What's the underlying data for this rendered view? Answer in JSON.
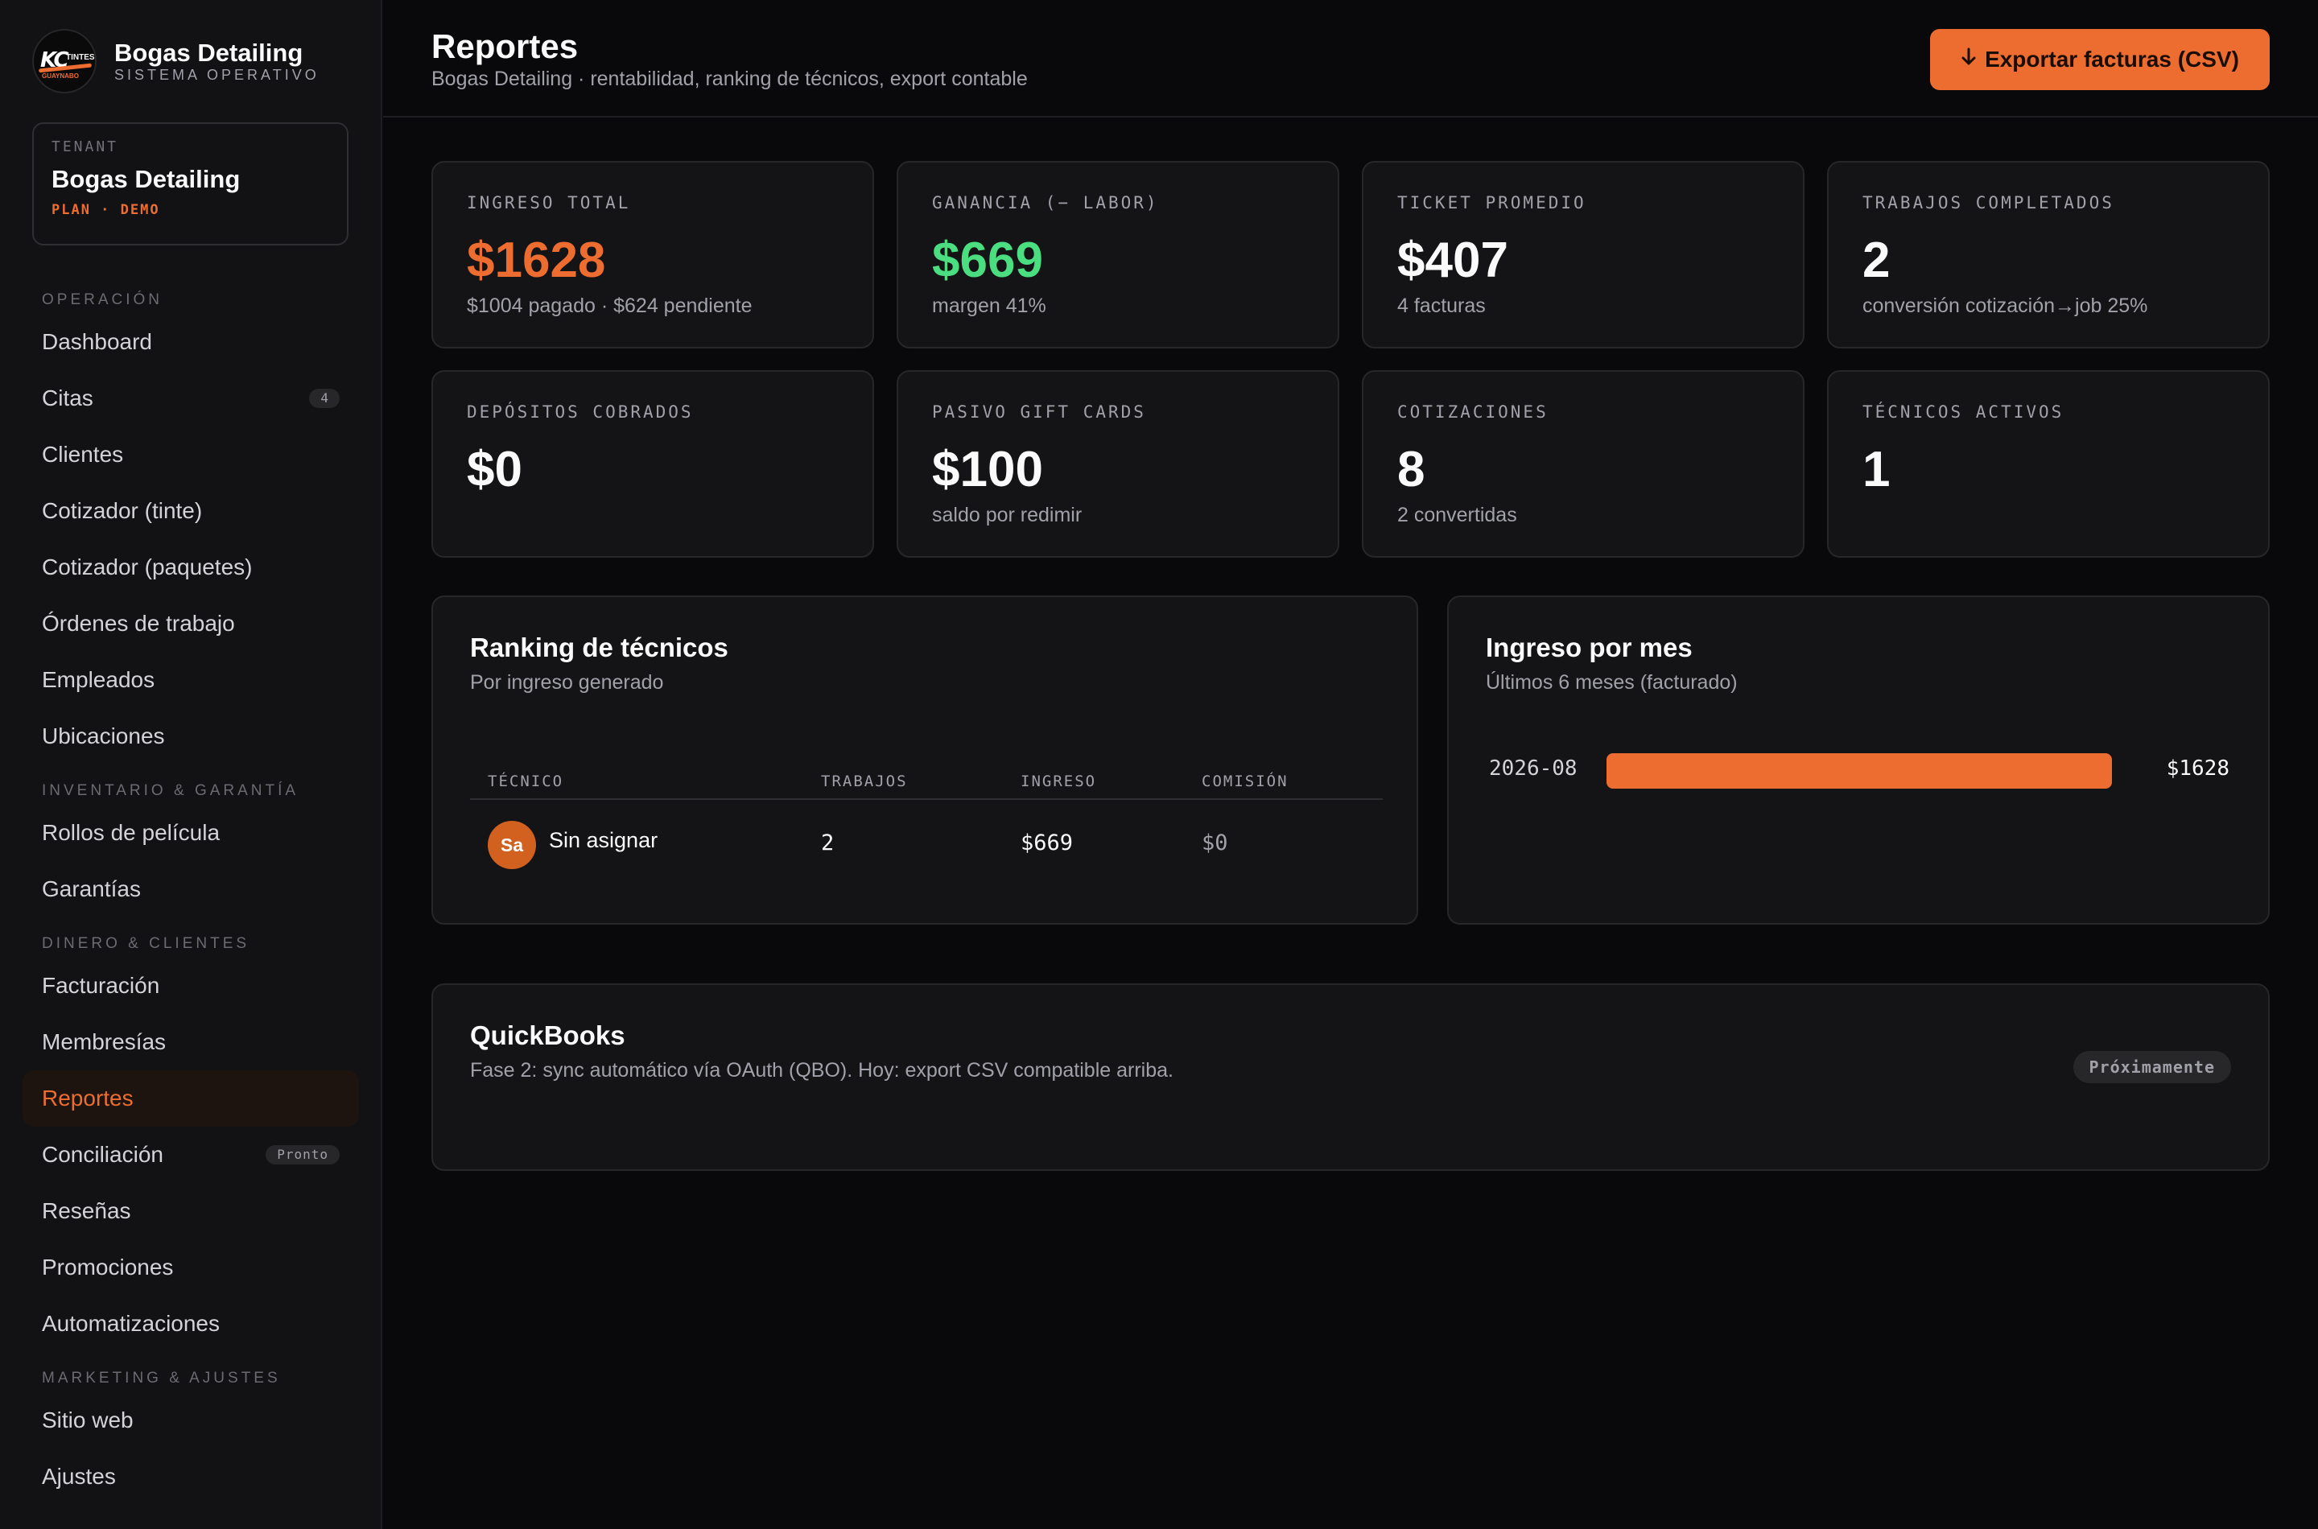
{
  "brand": {
    "name": "Bogas Detailing",
    "subtitle": "SISTEMA OPERATIVO",
    "logo_text": {
      "mark": "KC",
      "tint": "TINTES",
      "town": "GUAYNABO"
    }
  },
  "tenant": {
    "label": "TENANT",
    "name": "Bogas Detailing",
    "plan": "PLAN · DEMO"
  },
  "sidebar": {
    "sections": [
      {
        "title": "OPERACIÓN",
        "items": [
          {
            "label": "Dashboard"
          },
          {
            "label": "Citas",
            "badge": "4"
          },
          {
            "label": "Clientes"
          },
          {
            "label": "Cotizador (tinte)"
          },
          {
            "label": "Cotizador (paquetes)"
          },
          {
            "label": "Órdenes de trabajo"
          },
          {
            "label": "Empleados"
          },
          {
            "label": "Ubicaciones"
          }
        ]
      },
      {
        "title": "INVENTARIO & GARANTÍA",
        "items": [
          {
            "label": "Rollos de película"
          },
          {
            "label": "Garantías"
          }
        ]
      },
      {
        "title": "DINERO & CLIENTES",
        "items": [
          {
            "label": "Facturación"
          },
          {
            "label": "Membresías"
          },
          {
            "label": "Reportes",
            "active": true
          },
          {
            "label": "Conciliación",
            "badge": "Pronto"
          },
          {
            "label": "Reseñas"
          },
          {
            "label": "Promociones"
          },
          {
            "label": "Automatizaciones"
          }
        ]
      },
      {
        "title": "MARKETING & AJUSTES",
        "items": [
          {
            "label": "Sitio web"
          },
          {
            "label": "Ajustes"
          }
        ]
      }
    ]
  },
  "header": {
    "title": "Reportes",
    "subtitle": "Bogas Detailing · rentabilidad, ranking de técnicos, export contable",
    "export_button": "Exportar facturas (CSV)",
    "export_icon": "arrow-down-icon"
  },
  "kpis": [
    {
      "label": "INGRESO TOTAL",
      "value": "$1628",
      "sub": "$1004 pagado · $624 pendiente",
      "accent": "orange"
    },
    {
      "label": "GANANCIA (− LABOR)",
      "value": "$669",
      "sub": "margen 41%",
      "accent": "green"
    },
    {
      "label": "TICKET PROMEDIO",
      "value": "$407",
      "sub": "4 facturas",
      "accent": "white"
    },
    {
      "label": "TRABAJOS COMPLETADOS",
      "value": "2",
      "sub": "conversión cotización→job 25%",
      "accent": "white"
    },
    {
      "label": "DEPÓSITOS COBRADOS",
      "value": "$0",
      "sub": "",
      "accent": "white"
    },
    {
      "label": "PASIVO GIFT CARDS",
      "value": "$100",
      "sub": "saldo por redimir",
      "accent": "white"
    },
    {
      "label": "COTIZACIONES",
      "value": "8",
      "sub": "2 convertidas",
      "accent": "white"
    },
    {
      "label": "TÉCNICOS ACTIVOS",
      "value": "1",
      "sub": "",
      "accent": "white"
    }
  ],
  "ranking": {
    "title": "Ranking de técnicos",
    "subtitle": "Por ingreso generado",
    "columns": [
      "TÉCNICO",
      "TRABAJOS",
      "INGRESO",
      "COMISIÓN"
    ],
    "rows": [
      {
        "initials": "Sa",
        "name": "Sin asignar",
        "jobs": "2",
        "revenue": "$669",
        "commission": "$0"
      }
    ]
  },
  "monthly": {
    "title": "Ingreso por mes",
    "subtitle": "Últimos 6 meses (facturado)",
    "rows": [
      {
        "month": "2026-08",
        "value": 1628,
        "label": "$1628",
        "fill_fraction": 1.0
      }
    ]
  },
  "quickbooks": {
    "title": "QuickBooks",
    "description": "Fase 2: sync automático vía OAuth (QBO). Hoy: export CSV compatible arriba.",
    "badge": "Próximamente"
  },
  "colors": {
    "accent": "#ed6d31",
    "green": "#4ade80",
    "background": "#09090b",
    "card": "#141417"
  }
}
